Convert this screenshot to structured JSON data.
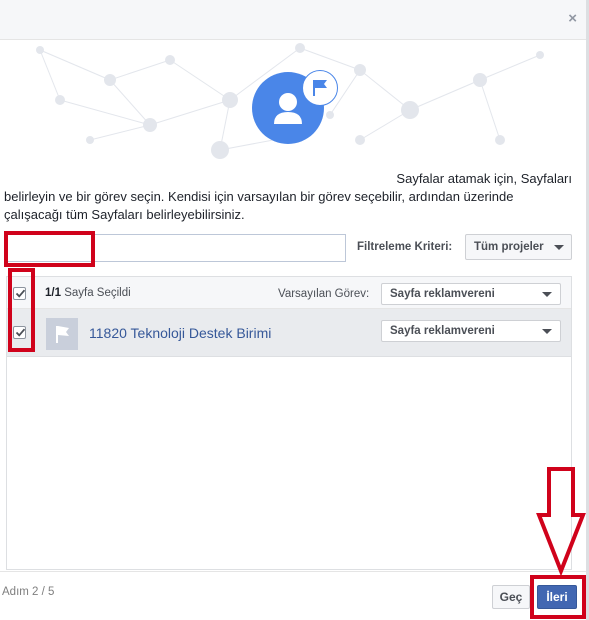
{
  "dialog": {
    "close_icon": "close-icon",
    "close_glyph": "×"
  },
  "intro": {
    "line1": "Sayfalar atamak için, Sayfaları",
    "line2": "belirleyin ve bir görev seçin. Kendisi için varsayılan bir görev seçebilir, ardından üzerinde",
    "line3": "çalışacağı tüm Sayfaları belirleyebilirsiniz."
  },
  "search": {
    "value": "",
    "placeholder": ""
  },
  "filter": {
    "label": "Filtreleme Kriteri:",
    "value": "Tüm projeler"
  },
  "list": {
    "selected_count": "1/1",
    "selected_text": "Sayfa Seçildi",
    "default_role_label": "Varsayılan Görev:",
    "default_role_value": "Sayfa reklamvereni",
    "header_checked": true,
    "pages": [
      {
        "name": "11820 Teknoloji Destek Birimi",
        "role": "Sayfa reklamvereni",
        "checked": true,
        "icon": "flag-icon"
      }
    ]
  },
  "footer": {
    "step": "Adım 2 / 5",
    "skip_label": "Geç",
    "next_label": "İleri"
  },
  "colors": {
    "accent": "#4267b2",
    "avatar": "#4a86e8",
    "highlight": "#d0021b",
    "row_bg": "#e9ebee",
    "link": "#365899"
  }
}
